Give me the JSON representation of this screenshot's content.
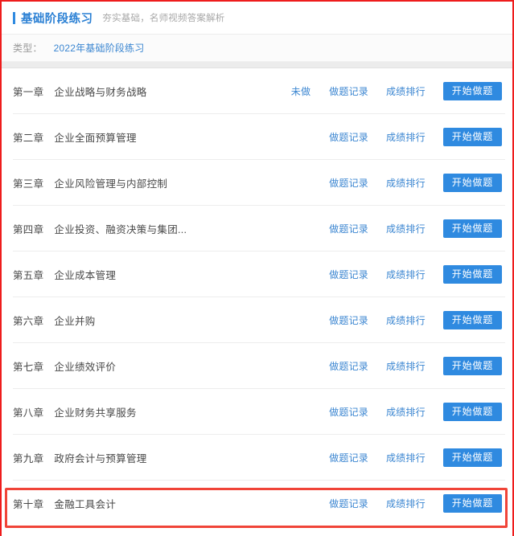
{
  "header": {
    "title": "基础阶段练习",
    "subtitle": "夯实基础，名师视频答案解析",
    "accent_color": "#2f8ae0"
  },
  "filter": {
    "label": "类型：",
    "selected_option": "2022年基础阶段练习",
    "link_color": "#3b86d1"
  },
  "actions": {
    "record_label": "做题记录",
    "ranking_label": "成绩排行",
    "start_label": "开始做题",
    "button_color": "#2f8ae0"
  },
  "annotation": {
    "color": "#f04438",
    "target_row_index": 9
  },
  "chapters": [
    {
      "num": "第一章",
      "title": "企业战略与财务战略",
      "status": "未做"
    },
    {
      "num": "第二章",
      "title": "企业全面预算管理",
      "status": ""
    },
    {
      "num": "第三章",
      "title": "企业风险管理与内部控制",
      "status": ""
    },
    {
      "num": "第四章",
      "title": "企业投资、融资决策与集团...",
      "status": ""
    },
    {
      "num": "第五章",
      "title": "企业成本管理",
      "status": ""
    },
    {
      "num": "第六章",
      "title": "企业并购",
      "status": ""
    },
    {
      "num": "第七章",
      "title": "企业绩效评价",
      "status": ""
    },
    {
      "num": "第八章",
      "title": "企业财务共享服务",
      "status": ""
    },
    {
      "num": "第九章",
      "title": "政府会计与预算管理",
      "status": ""
    },
    {
      "num": "第十章",
      "title": "金融工具会计",
      "status": ""
    }
  ]
}
